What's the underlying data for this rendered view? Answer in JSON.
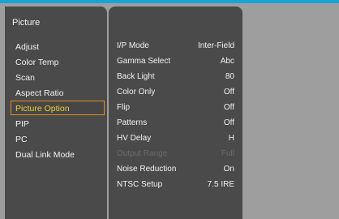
{
  "menu": {
    "title": "Picture",
    "items": [
      {
        "label": "Adjust"
      },
      {
        "label": "Color Temp"
      },
      {
        "label": "Scan"
      },
      {
        "label": "Aspect Ratio"
      },
      {
        "label": "Picture Option",
        "selected": true
      },
      {
        "label": "PIP"
      },
      {
        "label": "PC"
      },
      {
        "label": "Dual Link Mode"
      }
    ]
  },
  "options": [
    {
      "label": "I/P Mode",
      "value": "Inter-Field"
    },
    {
      "label": "Gamma Select",
      "value": "Abc"
    },
    {
      "label": "Back Light",
      "value": "80"
    },
    {
      "label": "Color Only",
      "value": "Off"
    },
    {
      "label": "Flip",
      "value": "Off"
    },
    {
      "label": "Patterns",
      "value": "Off"
    },
    {
      "label": "HV Delay",
      "value": "H"
    },
    {
      "label": "Output Range",
      "value": "Full",
      "disabled": true
    },
    {
      "label": "Noise Reduction",
      "value": "On"
    },
    {
      "label": "NTSC Setup",
      "value": "7.5 IRE"
    }
  ],
  "colors": {
    "accent_bar": "#1aa3d6",
    "selection_border": "#e58a1f",
    "selection_text": "#f0d130",
    "panel_bg": "#4a4a4a",
    "screen_bg": "#9e9e9e"
  }
}
